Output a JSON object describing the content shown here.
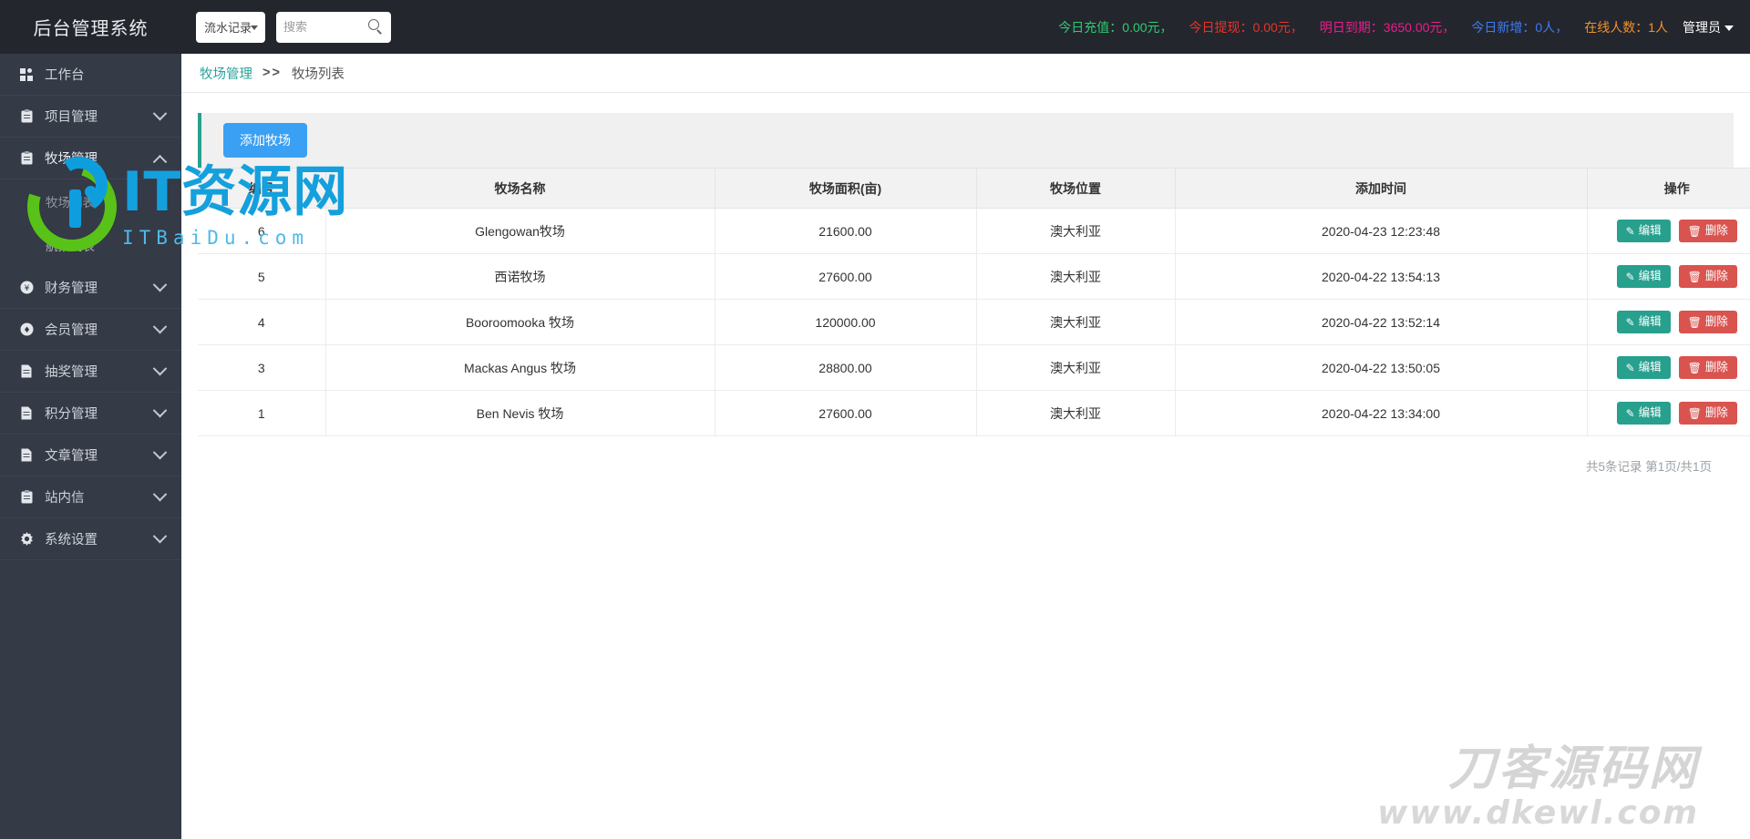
{
  "topbar": {
    "brand": "后台管理系统",
    "module_select": {
      "value": "流水记录",
      "caret_icon": "caret-down-icon"
    },
    "search": {
      "value": "",
      "placeholder": "搜索",
      "icon": "search-icon"
    },
    "stats": [
      {
        "label": "今日充值：",
        "value": "0.00元，",
        "color": "#2ecc71"
      },
      {
        "label": "今日提现：",
        "value": "0.00元，",
        "color": "#e5342b"
      },
      {
        "label": "明日到期：",
        "value": "3650.00元，",
        "color": "#e91e8c"
      },
      {
        "label": "今日新增：",
        "value": "0人，",
        "color": "#3d7cf0"
      },
      {
        "label": "在线人数：",
        "value": "1人",
        "color": "#f0922b"
      }
    ],
    "admin": {
      "label": "管理员",
      "icon": "chevron-down-icon"
    }
  },
  "sidebar": {
    "items": [
      {
        "label": "工作台",
        "icon": "dashboard-icon",
        "expandable": false,
        "expanded": false
      },
      {
        "label": "项目管理",
        "icon": "clipboard-icon",
        "expandable": true,
        "expanded": false
      },
      {
        "label": "牧场管理",
        "icon": "clipboard-icon",
        "expandable": true,
        "expanded": true,
        "children": [
          {
            "label": "牧场列表",
            "selected": true
          },
          {
            "label": "航拍列表",
            "selected": false
          }
        ]
      },
      {
        "label": "财务管理",
        "icon": "yen-icon",
        "expandable": true,
        "expanded": false
      },
      {
        "label": "会员管理",
        "icon": "member-icon",
        "expandable": true,
        "expanded": false
      },
      {
        "label": "抽奖管理",
        "icon": "file-icon",
        "expandable": true,
        "expanded": false
      },
      {
        "label": "积分管理",
        "icon": "file-icon",
        "expandable": true,
        "expanded": false
      },
      {
        "label": "文章管理",
        "icon": "file-icon",
        "expandable": true,
        "expanded": false
      },
      {
        "label": "站内信",
        "icon": "clipboard-icon",
        "expandable": true,
        "expanded": false
      },
      {
        "label": "系统设置",
        "icon": "gear-icon",
        "expandable": true,
        "expanded": false
      }
    ]
  },
  "breadcrumb": {
    "parent": "牧场管理",
    "separator": ">>",
    "current": "牧场列表"
  },
  "toolbar": {
    "add_label": "添加牧场"
  },
  "table": {
    "columns": [
      "编号",
      "牧场名称",
      "牧场面积(亩)",
      "牧场位置",
      "添加时间",
      "操作"
    ],
    "rows": [
      {
        "id": "6",
        "name": "Glengowan牧场",
        "area": "21600.00",
        "location": "澳大利亚",
        "created": "2020-04-23 12:23:48"
      },
      {
        "id": "5",
        "name": "西诺牧场",
        "area": "27600.00",
        "location": "澳大利亚",
        "created": "2020-04-22 13:54:13"
      },
      {
        "id": "4",
        "name": "Booroomooka 牧场",
        "area": "120000.00",
        "location": "澳大利亚",
        "created": "2020-04-22 13:52:14"
      },
      {
        "id": "3",
        "name": "Mackas Angus 牧场",
        "area": "28800.00",
        "location": "澳大利亚",
        "created": "2020-04-22 13:50:05"
      },
      {
        "id": "1",
        "name": "Ben Nevis 牧场",
        "area": "27600.00",
        "location": "澳大利亚",
        "created": "2020-04-22 13:34:00"
      }
    ],
    "actions": {
      "edit_label": "编辑",
      "edit_icon": "pencil-square-icon",
      "edit_color": "#27a08e",
      "delete_label": "删除",
      "delete_icon": "trash-icon",
      "delete_color": "#d9534f"
    }
  },
  "pager": {
    "text": "共5条记录 第1页/共1页"
  },
  "watermarks": {
    "left": {
      "title": "IT资源网",
      "subtitle": "ITBaiDu.com",
      "logo_icon": "ring-logo-icon"
    },
    "right": {
      "title": "刀客源码网",
      "subtitle": "www.dkewl.com"
    }
  },
  "colors": {
    "brand_dark": "#24262e",
    "sidebar": "#343a46",
    "accent_teal": "#27a08e",
    "accent_blue": "#3aa0f3"
  }
}
